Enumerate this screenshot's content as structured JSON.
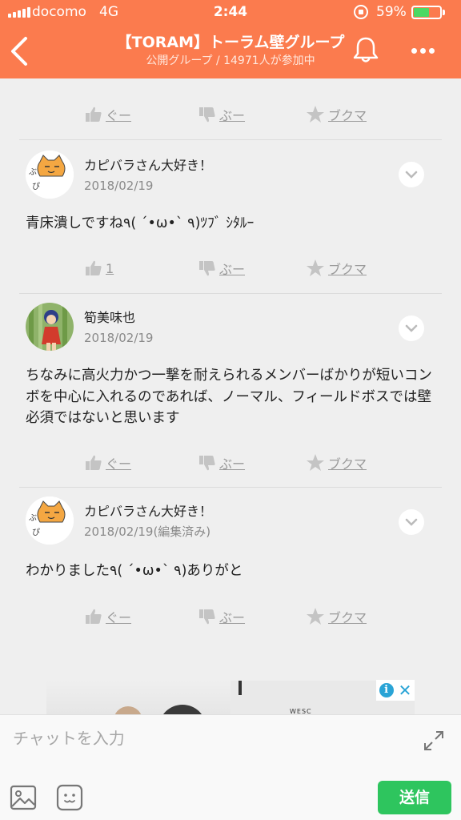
{
  "status_bar": {
    "carrier": "docomo",
    "network": "4G",
    "time": "2:44",
    "battery_percent_text": "59%",
    "battery_level": 0.59,
    "battery_fill_color": "#4cd964"
  },
  "header": {
    "title": "【TORAM】トーラム壁グループ",
    "subtitle": "公開グループ / 14971人が参加中",
    "background_color": "#fb7b4e"
  },
  "actions": {
    "good_label": "ぐー",
    "boo_label": "ぶー",
    "bookmark_label": "ブクマ"
  },
  "posts": [
    {
      "username": "カピバラさん大好き！",
      "date": "2018/02/19",
      "body": "青床潰しですね٩( ´•ω•` ٩)ﾂﾌﾞ ｼﾀﾙｰ",
      "good_display": "1"
    },
    {
      "username": "筍美味也",
      "date": "2018/02/19",
      "body": "ちなみに高火力かつ一撃を耐えられるメンバーばかりが短いコンボを中心に入れるのであれば、ノーマル、フィールドボスでは壁必須ではないと思います",
      "good_display": "ぐー"
    },
    {
      "username": "カピバラさん大好き！",
      "date": "2018/02/19(編集済み)",
      "body": "わかりました٩( ´•ω•` ٩)ありがと",
      "good_display": "ぐー"
    }
  ],
  "ad": {
    "brand_text": "WESC"
  },
  "composer": {
    "placeholder": "チャットを入力",
    "send_label": "送信",
    "send_color": "#2ec55e"
  }
}
